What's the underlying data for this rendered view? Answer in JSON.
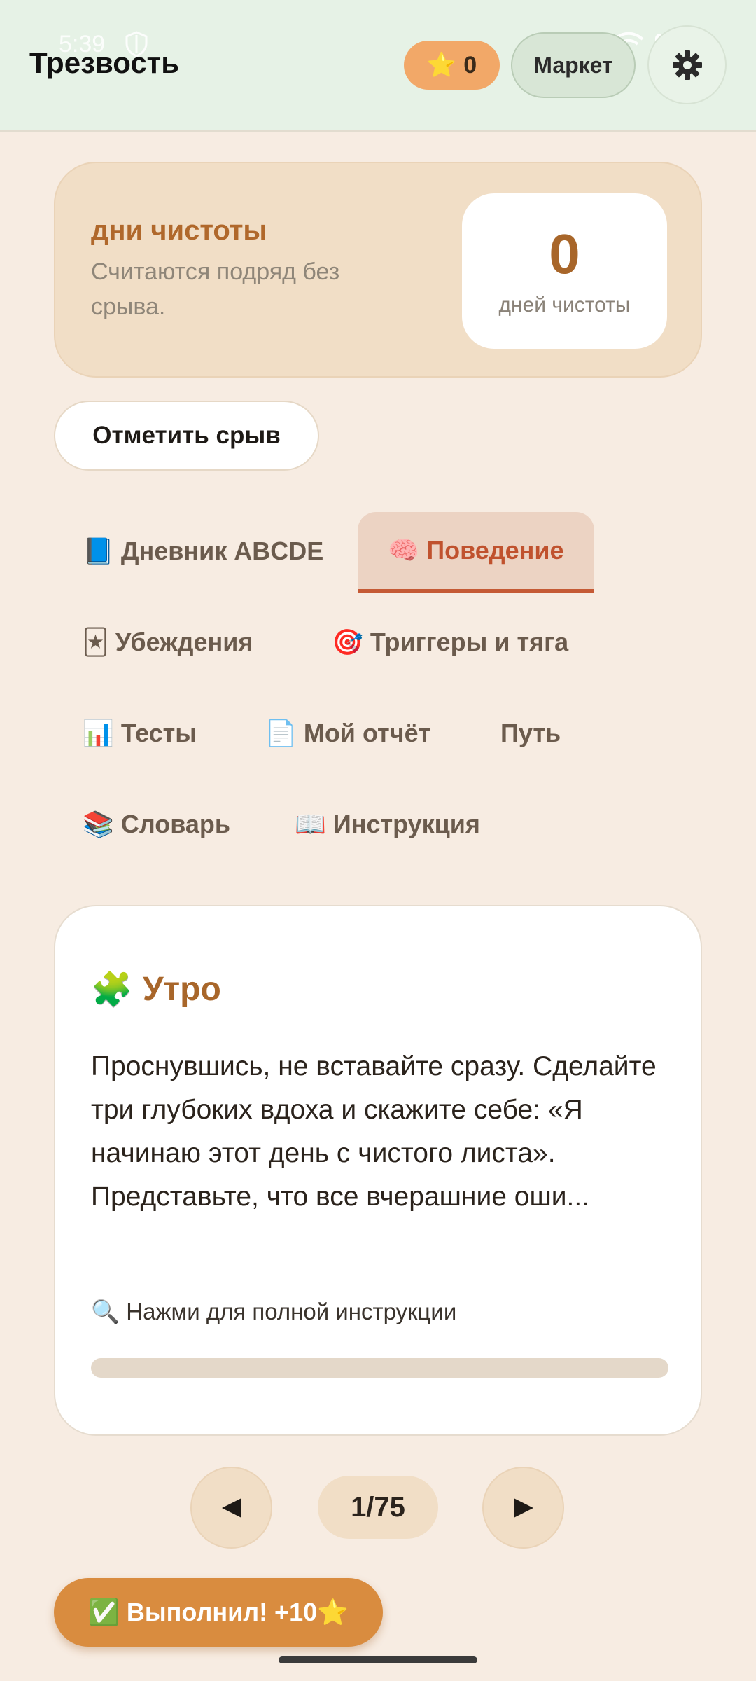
{
  "status_bar": {
    "time": "5:39"
  },
  "header": {
    "title": "Трезвость",
    "stars": "0",
    "market_label": "Маркет"
  },
  "streak": {
    "title": "дни чистоты",
    "description": "Считаются подряд без срыва.",
    "count": "0",
    "unit": "дней чистоты"
  },
  "relapse_button": "Отметить срыв",
  "tabs": [
    {
      "icon": "📘",
      "label": "Дневник ABCDE",
      "active": false
    },
    {
      "icon": "🧠",
      "label": "Поведение",
      "active": true
    },
    {
      "icon": "🃏",
      "label": "Убеждения",
      "active": false
    },
    {
      "icon": "🎯",
      "label": "Триггеры и тяга",
      "active": false
    },
    {
      "icon": "📊",
      "label": "Тесты",
      "active": false
    },
    {
      "icon": "📄",
      "label": "Мой отчёт",
      "active": false
    },
    {
      "icon": "",
      "label": "Путь",
      "active": false
    },
    {
      "icon": "📚",
      "label": "Словарь",
      "active": false
    },
    {
      "icon": "📖",
      "label": "Инструкция",
      "active": false
    }
  ],
  "instruction": {
    "icon": "🧩",
    "title": "Утро",
    "text": "Проснувшись, не вставайте сразу. Сделайте три глубоких вдоха и скажите себе: «Я начинаю этот день с чистого листа». Представьте, что все вчерашние оши...",
    "hint_icon": "🔍",
    "hint": "Нажми для полной инструкции",
    "progress": 0
  },
  "pager": {
    "label": "1/75"
  },
  "done_button": "✅ Выполнил! +10⭐",
  "colors": {
    "header_bg": "#e6f2e6",
    "page_bg": "#f7ece2",
    "accent": "#a8662a",
    "tab_active": "#c0522e",
    "done_button": "#d98c3f",
    "stars_pill": "#f2a868"
  }
}
